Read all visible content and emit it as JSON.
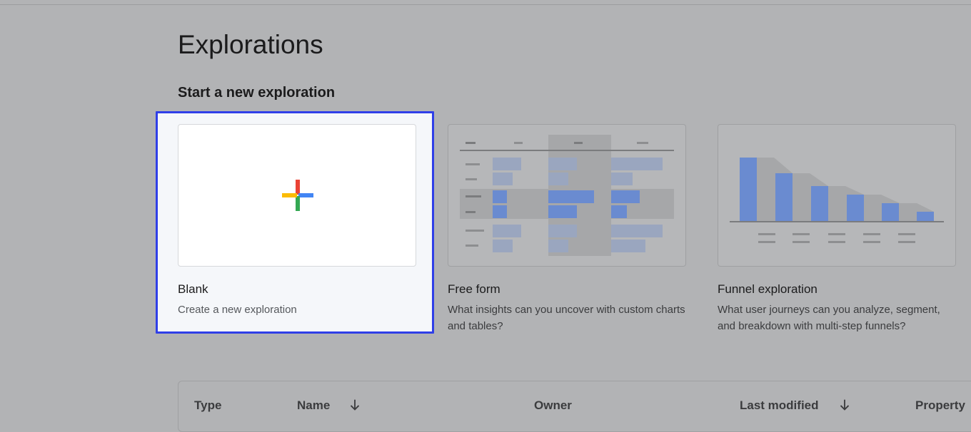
{
  "page": {
    "title": "Explorations",
    "section_heading": "Start a new exploration"
  },
  "templates": [
    {
      "name": "Blank",
      "description": "Create a new exploration",
      "thumbnail_icon": "plus-icon",
      "selected": true
    },
    {
      "name": "Free form",
      "description": "What insights can you uncover with custom charts and tables?",
      "thumbnail_icon": "table-preview-icon",
      "selected": false
    },
    {
      "name": "Funnel exploration",
      "description": "What user journeys can you analyze, segment, and breakdown with multi-step funnels?",
      "thumbnail_icon": "funnel-chart-preview-icon",
      "selected": false
    }
  ],
  "table": {
    "columns": [
      {
        "label": "Type",
        "sortable": false
      },
      {
        "label": "Name",
        "sortable": true,
        "sort_icon": "arrow-down-icon"
      },
      {
        "label": "Owner",
        "sortable": false
      },
      {
        "label": "Last modified",
        "sortable": true,
        "sort_icon": "arrow-down-icon"
      },
      {
        "label": "Property",
        "sortable": false
      }
    ]
  },
  "colors": {
    "highlight_border": "#2f3fe8",
    "plus_red": "#ea4335",
    "plus_blue": "#4285f4",
    "plus_green": "#34a853",
    "plus_yellow": "#fbbc04",
    "preview_blue": "#6a8bd0"
  }
}
